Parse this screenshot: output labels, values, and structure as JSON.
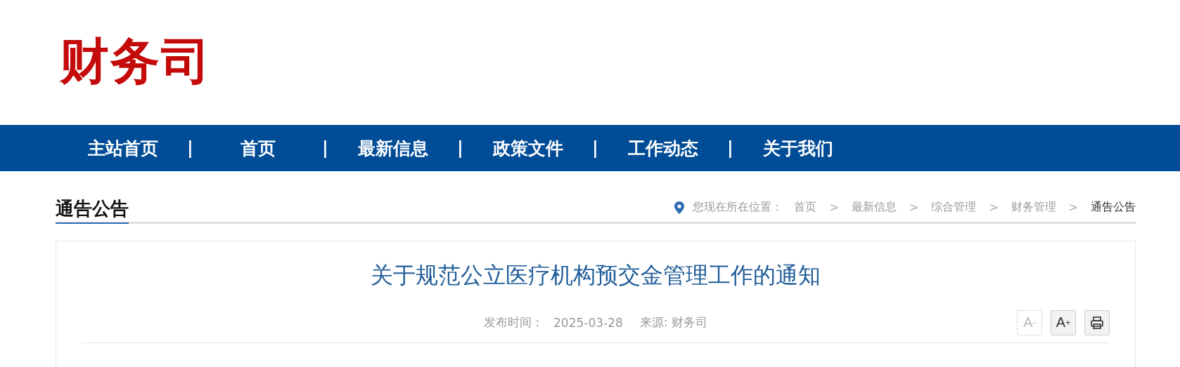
{
  "logo": "财务司",
  "nav": [
    {
      "label": "主站首页",
      "separator": "|"
    },
    {
      "label": "首页",
      "separator": "|"
    },
    {
      "label": "最新信息",
      "separator": "|"
    },
    {
      "label": "政策文件",
      "separator": "|"
    },
    {
      "label": "工作动态",
      "separator": "|"
    },
    {
      "label": "关于我们"
    }
  ],
  "section_title": "通告公告",
  "breadcrumb": {
    "prefix": "您现在所在位置：",
    "items": [
      {
        "label": "首页",
        "current": false,
        "separator": ">"
      },
      {
        "label": "最新信息",
        "current": false,
        "separator": ">"
      },
      {
        "label": "综合管理",
        "current": false,
        "separator": ">"
      },
      {
        "label": "财务管理",
        "current": false,
        "separator": ">"
      },
      {
        "label": "通告公告",
        "current": true
      }
    ]
  },
  "article": {
    "title": "关于规范公立医疗机构预交金管理工作的通知",
    "date_label": "发布时间：",
    "date": "2025-03-28",
    "source": "来源: 财务司",
    "tools": [
      {
        "kind": "font",
        "letter": "A",
        "sign": "-",
        "disabled": true
      },
      {
        "kind": "font",
        "letter": "A",
        "sign": "+",
        "disabled": false
      },
      {
        "kind": "print",
        "disabled": false
      }
    ]
  }
}
